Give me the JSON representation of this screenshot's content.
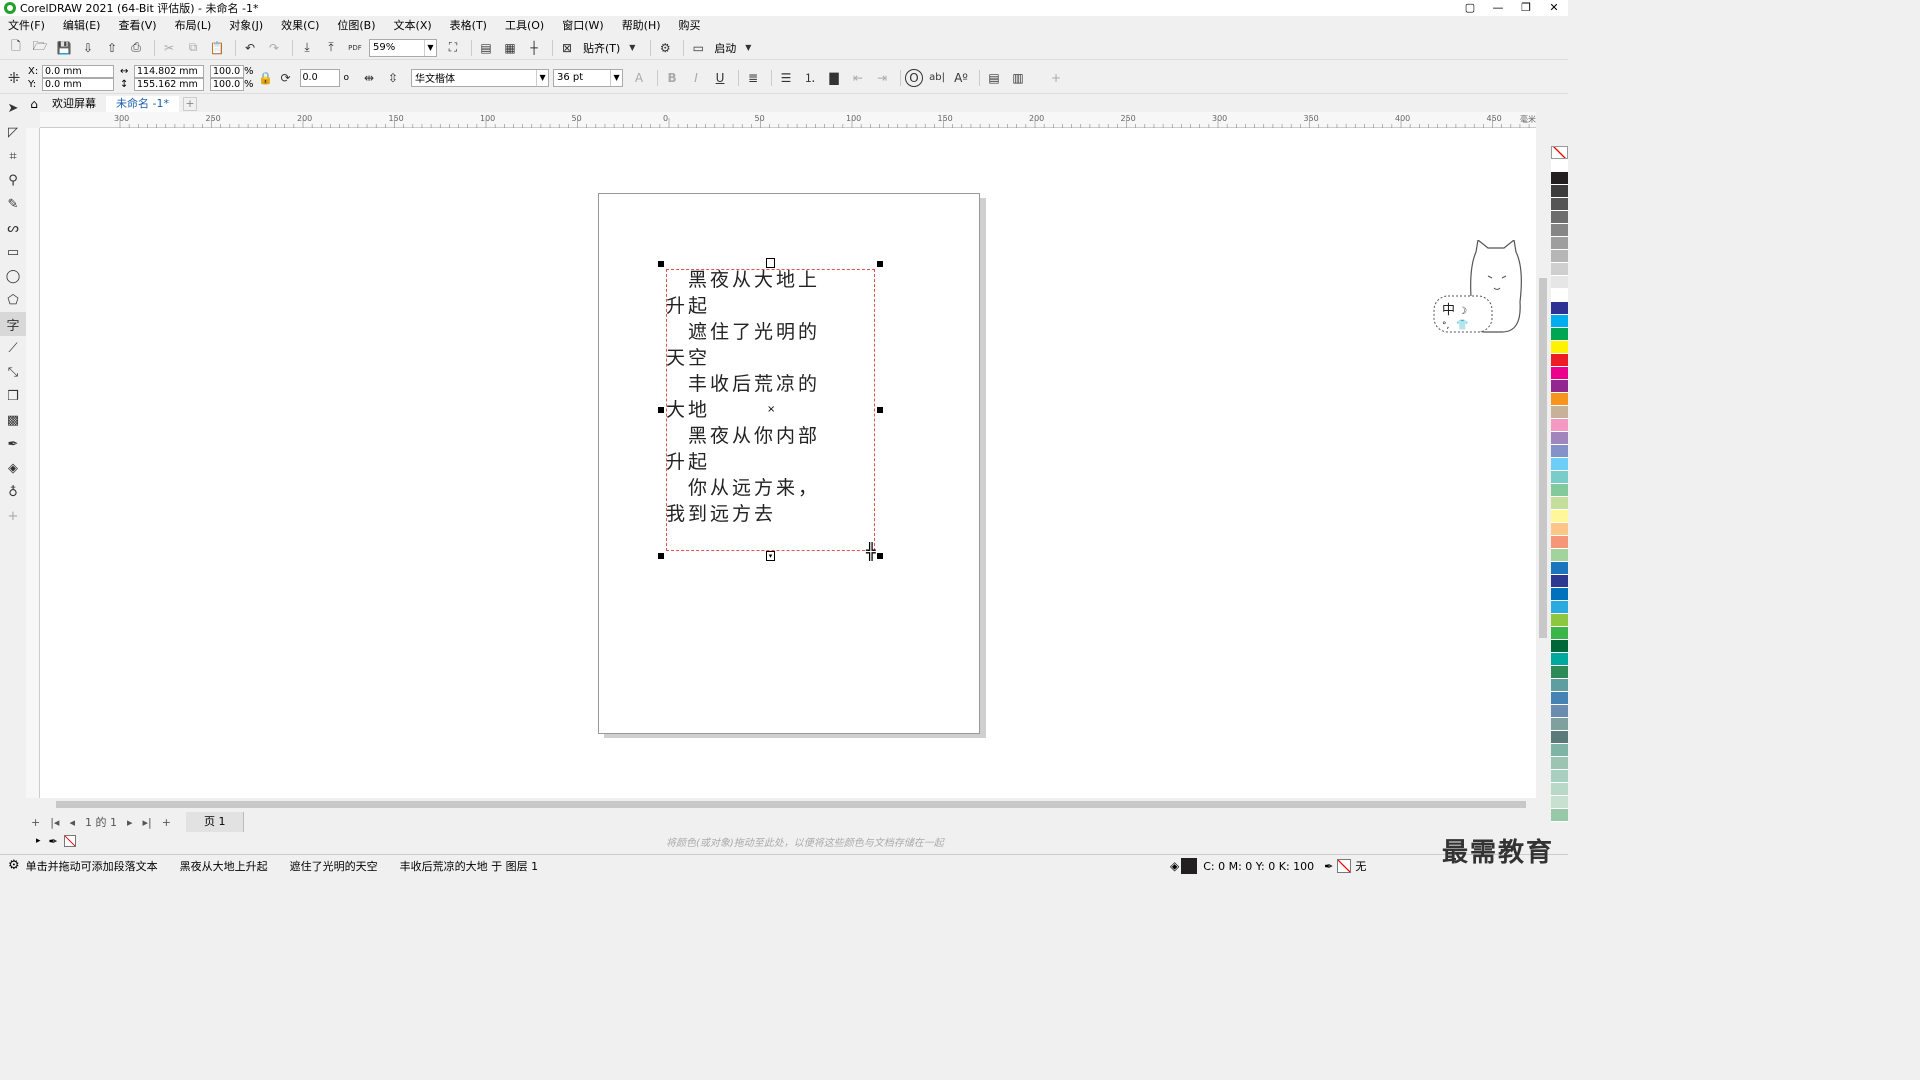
{
  "window": {
    "title": "CorelDRAW 2021 (64-Bit 评估版) - 未命名 -1*",
    "controls": [
      "▢",
      "—",
      "❐",
      "✕"
    ]
  },
  "menu": [
    "文件(F)",
    "编辑(E)",
    "查看(V)",
    "布局(L)",
    "对象(J)",
    "效果(C)",
    "位图(B)",
    "文本(X)",
    "表格(T)",
    "工具(O)",
    "窗口(W)",
    "帮助(H)",
    "购买"
  ],
  "toolbar": {
    "zoom": "59%",
    "snap_label": "贴齐(T)",
    "launch_label": "启动",
    "pdf_label": "PDF"
  },
  "properties": {
    "x_label": "X:",
    "y_label": "Y:",
    "x": "0.0 mm",
    "y": "0.0 mm",
    "width": "114.802 mm",
    "height": "155.162 mm",
    "scale_w": "100.0",
    "scale_h": "100.0",
    "percent": "%",
    "rotation": "0.0",
    "degree": "o",
    "font": "华文楷体",
    "font_size": "36 pt"
  },
  "tabs": {
    "welcome": "欢迎屏幕",
    "doc": "未命名 -1*"
  },
  "ruler": {
    "h_labels": [
      "300",
      "250",
      "200",
      "150",
      "100",
      "50",
      "0",
      "50",
      "100",
      "150",
      "200",
      "250",
      "300",
      "350",
      "400",
      "450"
    ],
    "h_unit": "毫米"
  },
  "text_lines": [
    "　黑夜从大地上",
    "升起",
    "　遮住了光明的",
    "天空",
    "　丰收后荒凉的",
    "大地",
    "　黑夜从你内部",
    "升起",
    "　你从远方来，",
    "我到远方去"
  ],
  "page_nav": {
    "counter": "1 的 1",
    "page_tab": "页 1"
  },
  "color_hint": "将颜色(或对象)拖动至此处，以便将这些颜色与文档存储在一起",
  "status": {
    "hint": "单击并拖动可添加段落文本",
    "item1": "黑夜从大地上升起",
    "item2": "遮住了光明的天空",
    "item3": "丰收后荒凉的大地 于 图层 1",
    "fill": "C: 0 M: 0 Y: 0 K: 100",
    "outline": "无"
  },
  "watermark": "最需教育",
  "palette": [
    "#ffffff",
    "#231f20",
    "#3c3c3c",
    "#555555",
    "#6d6d6d",
    "#858585",
    "#9e9e9e",
    "#b6b6b6",
    "#cfcfcf",
    "#e6e6e6",
    "#ffffff",
    "#2e3192",
    "#00aeef",
    "#00a651",
    "#fff200",
    "#ed1c24",
    "#ec008c",
    "#92278f",
    "#f7941d",
    "#c7b299",
    "#f49ac2",
    "#a186be",
    "#8393ca",
    "#6dcff6",
    "#7accc8",
    "#82ca9c",
    "#c4df9b",
    "#fff799",
    "#fdc689",
    "#f69679",
    "#a3d39c",
    "#1b75bc",
    "#2b3990",
    "#0072bc",
    "#29abe2",
    "#8dc63f",
    "#39b54a",
    "#006838",
    "#00a99d",
    "#2e8b57",
    "#5f9ea0",
    "#4682b4",
    "#6a8caf",
    "#80a0a0",
    "#5b7b7b",
    "#7fb3a6",
    "#9cc4b2",
    "#a8cfbf",
    "#b8d8c8",
    "#c8e0d0",
    "#98c8a8"
  ]
}
